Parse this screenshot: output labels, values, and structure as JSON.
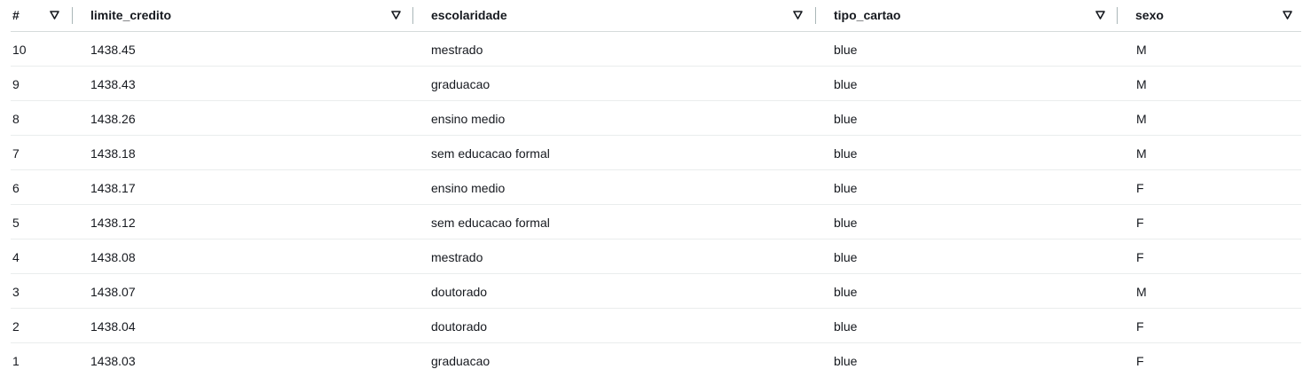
{
  "table": {
    "columns": [
      {
        "key": "index",
        "label": "#"
      },
      {
        "key": "limite_credito",
        "label": "limite_credito"
      },
      {
        "key": "escolaridade",
        "label": "escolaridade"
      },
      {
        "key": "tipo_cartao",
        "label": "tipo_cartao"
      },
      {
        "key": "sexo",
        "label": "sexo"
      }
    ],
    "sort_icon": "sort-triangle-down-icon",
    "rows": [
      [
        "10",
        "1438.45",
        "mestrado",
        "blue",
        "M"
      ],
      [
        "9",
        "1438.43",
        "graduacao",
        "blue",
        "M"
      ],
      [
        "8",
        "1438.26",
        "ensino medio",
        "blue",
        "M"
      ],
      [
        "7",
        "1438.18",
        "sem educacao formal",
        "blue",
        "M"
      ],
      [
        "6",
        "1438.17",
        "ensino medio",
        "blue",
        "F"
      ],
      [
        "5",
        "1438.12",
        "sem educacao formal",
        "blue",
        "F"
      ],
      [
        "4",
        "1438.08",
        "mestrado",
        "blue",
        "F"
      ],
      [
        "3",
        "1438.07",
        "doutorado",
        "blue",
        "M"
      ],
      [
        "2",
        "1438.04",
        "doutorado",
        "blue",
        "F"
      ],
      [
        "1",
        "1438.03",
        "graduacao",
        "blue",
        "F"
      ]
    ]
  }
}
